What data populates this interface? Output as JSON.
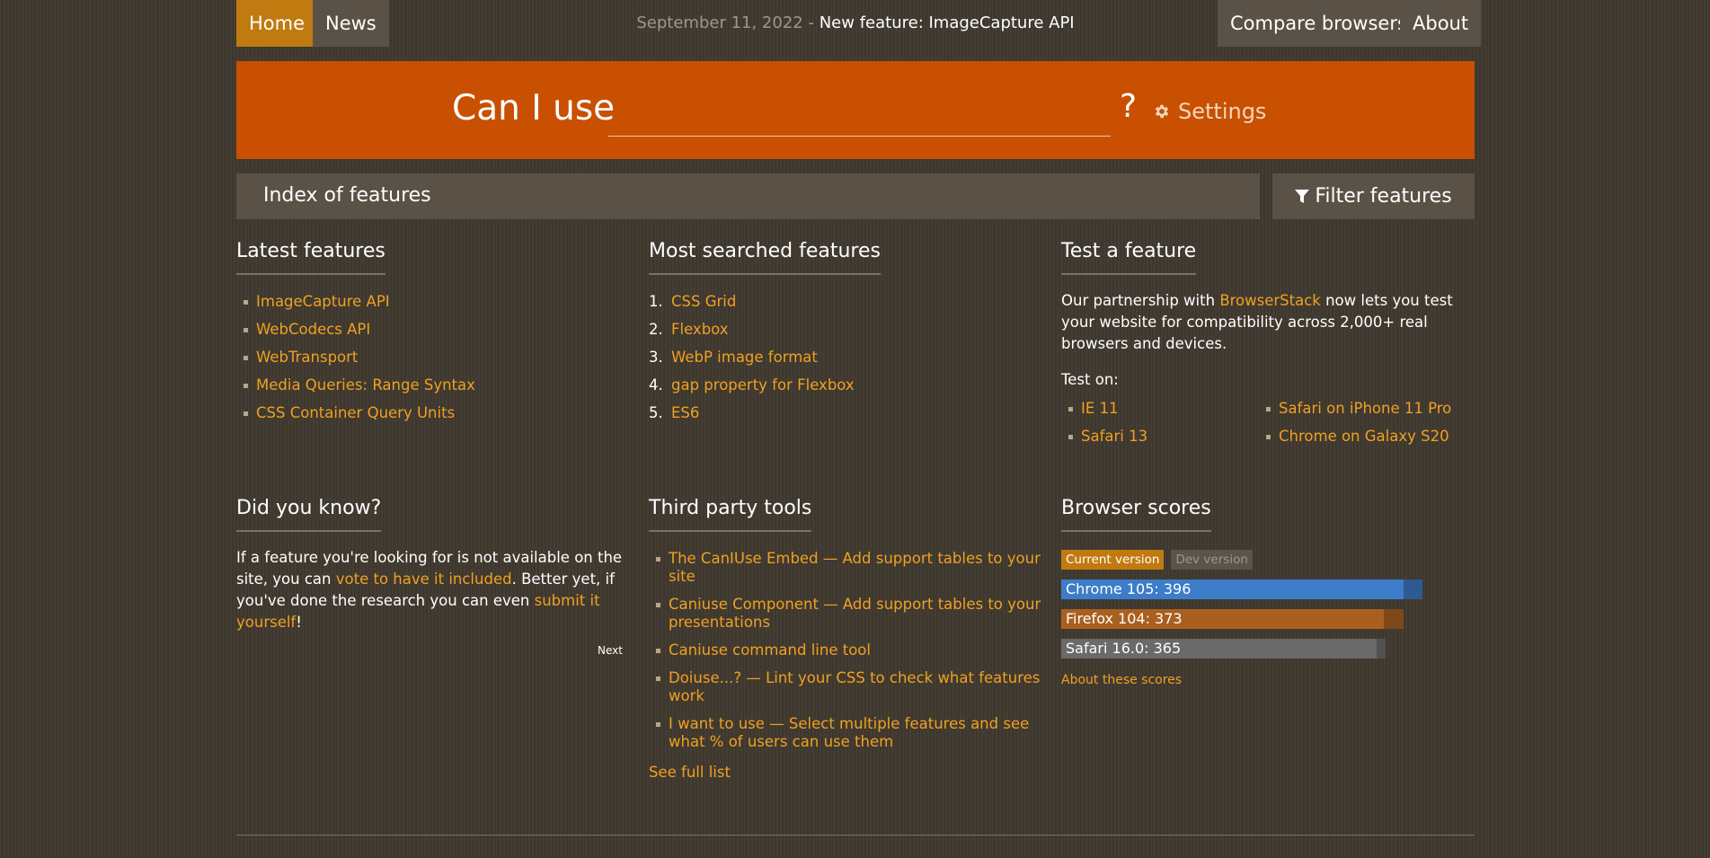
{
  "nav": {
    "home": "Home",
    "news": "News",
    "compare": "Compare browsers",
    "about": "About"
  },
  "newsline": {
    "date": "September 11, 2022",
    "separator": "-",
    "headline": "New feature: ImageCapture API"
  },
  "search": {
    "label": "Can I use",
    "value": "",
    "question_mark": "?",
    "settings_label": "Settings",
    "settings_icon": "gear-icon"
  },
  "index_bar": {
    "title": "Index of features",
    "filter_label": "Filter features",
    "filter_icon": "filter-icon"
  },
  "latest": {
    "title": "Latest features",
    "items": [
      "ImageCapture API",
      "WebCodecs API",
      "WebTransport",
      "Media Queries: Range Syntax",
      "CSS Container Query Units"
    ]
  },
  "most_searched": {
    "title": "Most searched features",
    "items": [
      {
        "n": "1.",
        "label": "CSS Grid"
      },
      {
        "n": "2.",
        "label": "Flexbox"
      },
      {
        "n": "3.",
        "label": "WebP image format"
      },
      {
        "n": "4.",
        "label": "gap property for Flexbox"
      },
      {
        "n": "5.",
        "label": "ES6"
      }
    ]
  },
  "test_feature": {
    "title": "Test a feature",
    "text_before": "Our partnership with ",
    "link": "BrowserStack",
    "text_after": " now lets you test your website for compatibility across 2,000+ real browsers and devices.",
    "test_on": "Test on:",
    "left_items": [
      "IE 11",
      "Safari 13"
    ],
    "right_items": [
      "Safari on iPhone 11 Pro",
      "Chrome on Galaxy S20"
    ]
  },
  "did_you_know": {
    "title": "Did you know?",
    "t1": "If a feature you're looking for is not available on the site, you can ",
    "link1": "vote to have it included",
    "t2": ". Better yet, if you've done the research you can even ",
    "link2": "submit it yourself",
    "t3": "!",
    "next": "Next"
  },
  "third_party": {
    "title": "Third party tools",
    "items": [
      "The CanIUse Embed — Add support tables to your site",
      "Caniuse Component — Add support tables to your presentations",
      "Caniuse command line tool",
      "Doiuse...? — Lint your CSS to check what features work",
      "I want to use — Select multiple features and see what % of users can use them"
    ],
    "see_full": "See full list"
  },
  "browser_scores": {
    "title": "Browser scores",
    "tab_current": "Current version",
    "tab_dev": "Dev version",
    "scores": [
      {
        "label": "Chrome 105: 396",
        "value": 396,
        "max_value": 418,
        "color": "#3d7cc9",
        "track_color": "#2f5a91"
      },
      {
        "label": "Firefox 104: 373",
        "value": 373,
        "max_value": 396,
        "color": "#a9601e",
        "track_color": "#804819"
      },
      {
        "label": "Safari 16.0: 365",
        "value": 365,
        "max_value": 375,
        "color": "#6a6a6a",
        "track_color": "#525252"
      }
    ],
    "about_link": "About these scores"
  },
  "colors": {
    "accent": "#c85000",
    "link": "#f0a022",
    "active_nav": "#c07a10",
    "background": "#3f392f"
  }
}
